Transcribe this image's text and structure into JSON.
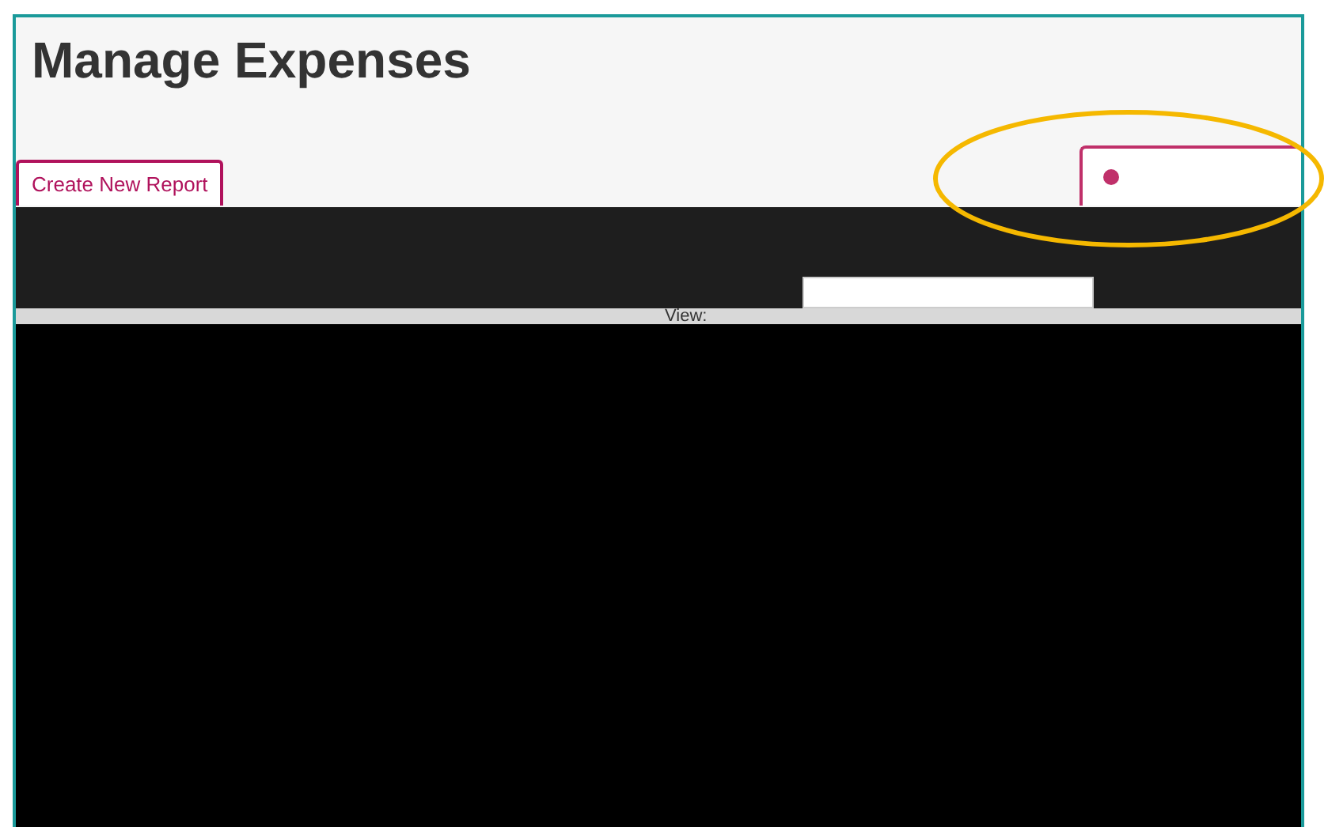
{
  "page": {
    "title": "Manage Expenses"
  },
  "toolbar": {
    "create_button": "Create New Report",
    "view_label": "View:"
  }
}
